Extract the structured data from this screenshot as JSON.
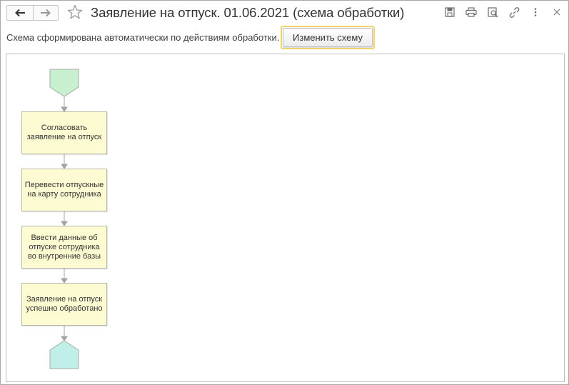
{
  "window": {
    "title": "Заявление на отпуск. 01.06.2021 (схема обработки)",
    "icons": {
      "back": "arrow-left-icon",
      "forward": "arrow-right-icon",
      "favorite": "star-icon",
      "save": "save-icon",
      "print": "print-icon",
      "preview": "preview-icon",
      "link": "link-icon",
      "more": "more-vertical-icon",
      "close": "close-icon"
    }
  },
  "info": {
    "text": "Схема сформирована автоматически по действиям обработки.",
    "change_button": "Изменить схему"
  },
  "diagram": {
    "start_color": "#c8f0cf",
    "end_color": "#c0efea",
    "step_color": "#fdfbd2",
    "steps": [
      "Согласовать заявление на отпуск",
      "Перевести отпускные на карту сотрудника",
      "Ввести данные об отпуске сотрудника во внутренние базы",
      "Заявление на отпуск успешно обработано"
    ]
  }
}
